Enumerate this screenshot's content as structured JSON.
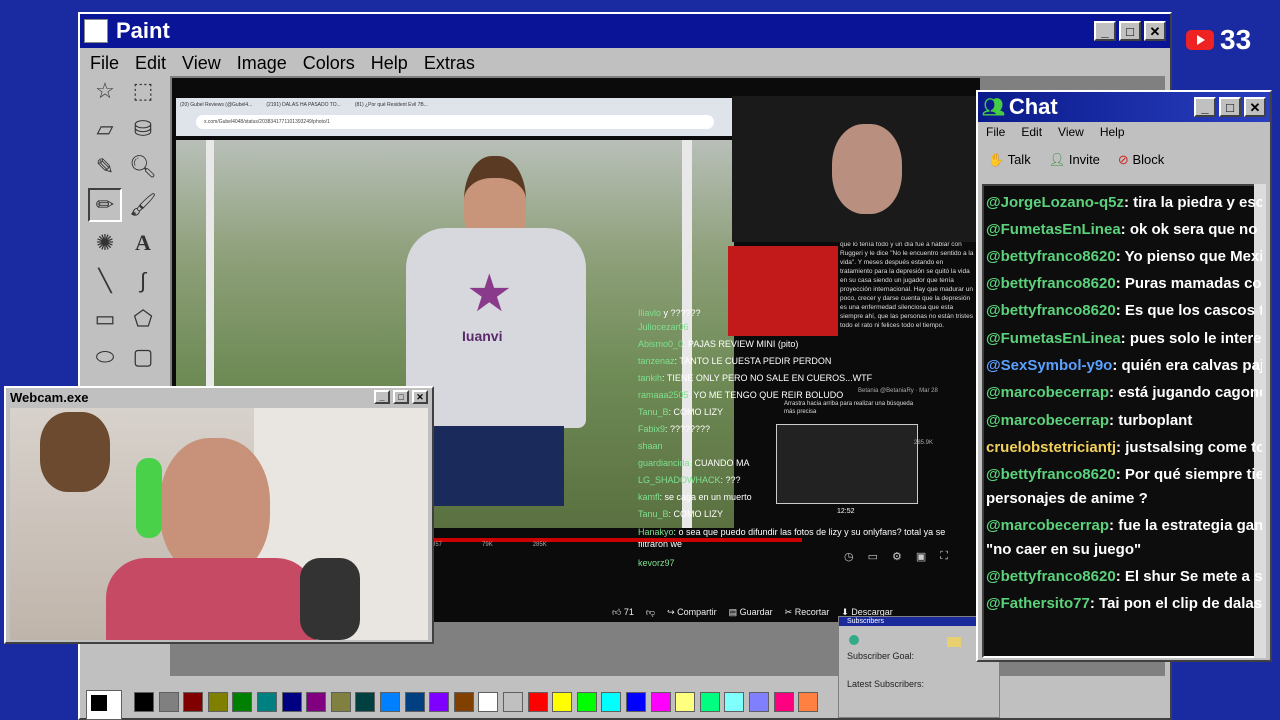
{
  "paint": {
    "title": "Paint",
    "menu": [
      "File",
      "Edit",
      "View",
      "Image",
      "Colors",
      "Help",
      "Extras"
    ]
  },
  "youtube_badge": {
    "count": "33"
  },
  "webcam": {
    "title": "Webcam.exe"
  },
  "browser": {
    "tabs": [
      "(20) Gubel Reviews (@Gubel4...",
      "(2191) DALAS HA PASADO TO...",
      "(81) ¿Por qué Resident Evil 7B..."
    ],
    "url": "x.com/Gubel4048/status/20383417711013932​49/photo/1"
  },
  "tweet_text": "que lo tenía todo y un día fue a hablar con Ruggeri y le dice \"No le encuentro sentido a la vida\". Y meses después estando en tratamiento para la depresión se quitó la vida en su casa siendo un jugador que tenía proyección internacional. Hay que madurar un poco, crecer y darse cuenta que la depresión es una enfermedad silenciosa que esta siempre ahí, que las personas no están tristes todo el rato ni felices todo el tiempo.",
  "shirt_logo": "Iuanvi",
  "overlay_chat": [
    {
      "user": "Iliavlo",
      "msg": "y ??????"
    },
    {
      "user": "Juliocezar06",
      "msg": ""
    },
    {
      "user": "Abismo0_0",
      "msg": ": PAJAS REVIEW MINI (pito)"
    },
    {
      "user": "tanzenaz",
      "msg": ": TANTO LE CUESTA PEDIR PERDON"
    },
    {
      "user": "tankih",
      "msg": ": TIENE ONLY PERO NO SALE EN CUEROS...WTF"
    },
    {
      "user": "ramaaa2505",
      "msg": ": YO ME TENGO QUE REIR BOLUDO"
    },
    {
      "user": "Tanu_B",
      "msg": ": COMO LIZY"
    },
    {
      "user": "Fabix9",
      "msg": ": ????????"
    },
    {
      "user": "shaan",
      "msg": ""
    },
    {
      "user": "guardiancida",
      "msg": ": CUANDO MA"
    },
    {
      "user": "LG_SHADOWHACK",
      "msg": ": ???"
    },
    {
      "user": "kamfl",
      "msg": ": se caga en un muerto"
    },
    {
      "user": "Tanu_B",
      "msg": ": COMO LIZY"
    },
    {
      "user": "Hanakyo",
      "msg": ": o sea que puedo difundir las fotos de lizy y su onlyfans? total ya se filtraron we"
    },
    {
      "user": "kevorz97",
      "msg": ""
    }
  ],
  "search_tip": "Arrastra hacia arriba para realizar una búsqueda más precisa",
  "small_profile": "Betania @BetaniaRy · Mar 28",
  "timestamp": "12:52",
  "counts": {
    "retweets": "857",
    "likes": "79K",
    "views": "285K",
    "views2": "285.9K"
  },
  "yt_bar": {
    "likes": "71",
    "share": "Compartir",
    "save": "Guardar",
    "clip": "Recortar",
    "download": "Descargar"
  },
  "subscribers": {
    "title": "Subscribers",
    "goal": "Subscriber Goal:",
    "latest": "Latest Subscribers:"
  },
  "chat": {
    "title": "Chat",
    "menu": [
      "File",
      "Edit",
      "View",
      "Help"
    ],
    "toolbar": {
      "talk": "Talk",
      "invite": "Invite",
      "block": "Block"
    },
    "messages": [
      {
        "user": "@JorgeLozano-q5z",
        "text": ": tira la piedra y escond"
      },
      {
        "user": "@FumetasEnLinea",
        "text": ": ok ok sera que no enter"
      },
      {
        "user": "@bettyfranco8620",
        "text": ": Yo pienso que Mexi sab"
      },
      {
        "user": "@bettyfranco8620",
        "text": ": Puras mamadas con el"
      },
      {
        "user": "@bettyfranco8620",
        "text": ": Es que los cascos trae"
      },
      {
        "user": "@FumetasEnLinea",
        "text": ": pues solo le interesa el"
      },
      {
        "user": "@SexSymbol-y9o",
        "text": ": quién era calvas pajas ?"
      },
      {
        "user": "@marcobecerrap",
        "text": ": está jugando cagoneta"
      },
      {
        "user": "@marcobecerrap",
        "text": ": turboplant"
      },
      {
        "user": "cruelobstetriciantj",
        "text": ": justsalsing come to us -"
      },
      {
        "user": "@bettyfranco8620",
        "text": ": Por qué siempre tiene c"
      },
      {
        "user": "",
        "text": "personajes de anime ?"
      },
      {
        "user": "@marcobecerrap",
        "text": ": fue la estrategia ganador"
      },
      {
        "user": "",
        "text": "\"no caer en su juego\""
      },
      {
        "user": "@bettyfranco8620",
        "text": ": El shur Se mete a su sa"
      },
      {
        "user": "@Fathersito77",
        "text": ": Tai pon el clip de dalas fing"
      }
    ]
  },
  "palette": [
    "#000000",
    "#808080",
    "#800000",
    "#808000",
    "#008000",
    "#008080",
    "#000080",
    "#800080",
    "#808040",
    "#004040",
    "#0080ff",
    "#004080",
    "#8000ff",
    "#804000",
    "#ffffff",
    "#c0c0c0",
    "#ff0000",
    "#ffff00",
    "#00ff00",
    "#00ffff",
    "#0000ff",
    "#ff00ff",
    "#ffff80",
    "#00ff80",
    "#80ffff",
    "#8080ff",
    "#ff0080",
    "#ff8040"
  ],
  "icons": [
    "star-select-icon",
    "rect-select-icon",
    "eraser-icon",
    "fill-icon",
    "picker-icon",
    "magnifier-icon",
    "pencil-icon",
    "brush-icon",
    "airbrush-icon",
    "text-icon",
    "line-icon",
    "curve-icon",
    "rectangle-icon",
    "polygon-icon",
    "ellipse-icon",
    "rounded-rect-icon"
  ]
}
